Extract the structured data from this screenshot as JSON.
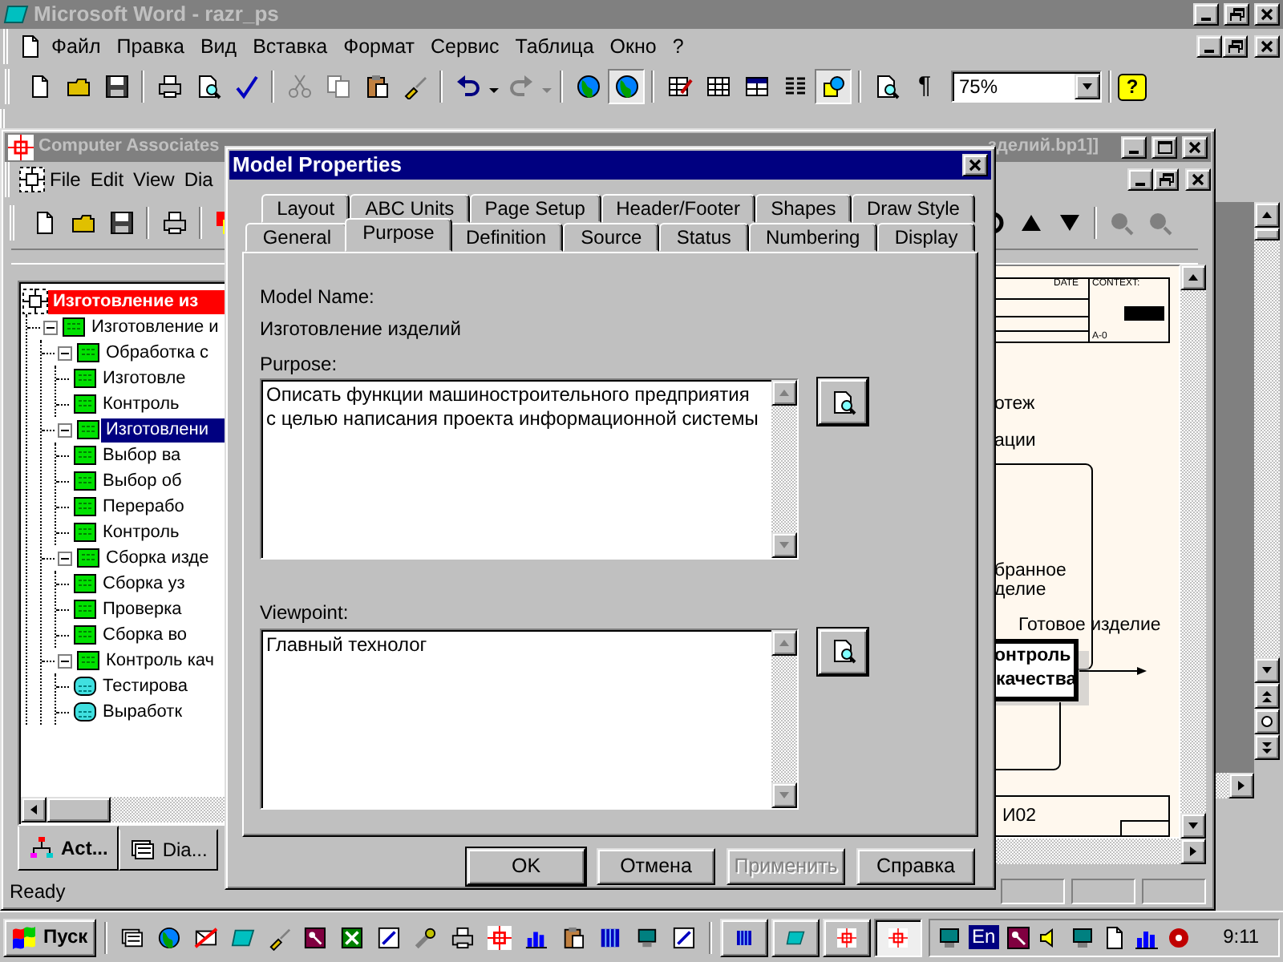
{
  "word_window": {
    "title": "Microsoft Word - razr_ps",
    "menu": [
      "Файл",
      "Правка",
      "Вид",
      "Вставка",
      "Формат",
      "Сервис",
      "Таблица",
      "Окно",
      "?"
    ],
    "pilcrow": "¶",
    "zoom": "75%",
    "help": "?"
  },
  "bpwin_window": {
    "title_left": "Computer Associates",
    "title_right": "зделий.bp1]]",
    "menu": [
      "File",
      "Edit",
      "View",
      "Dia"
    ],
    "tree": [
      {
        "label": "Изготовление из",
        "kind": "root",
        "selected": false,
        "children": [
          {
            "label": "Изготовление и",
            "kind": "box",
            "selected": false,
            "expanded": true,
            "children": [
              {
                "label": "Обработка  с",
                "kind": "box",
                "selected": false,
                "expanded": true,
                "children": [
                  {
                    "label": "Изготовле",
                    "kind": "box",
                    "selected": false
                  },
                  {
                    "label": "Контроль",
                    "kind": "box",
                    "selected": false
                  }
                ]
              },
              {
                "label": "Изготовлени",
                "kind": "box",
                "selected": true,
                "expanded": true,
                "children": [
                  {
                    "label": "Выбор  ва",
                    "kind": "box",
                    "selected": false
                  },
                  {
                    "label": "Выбор об",
                    "kind": "box",
                    "selected": false
                  },
                  {
                    "label": "Перерабо",
                    "kind": "box",
                    "selected": false
                  },
                  {
                    "label": "Контроль",
                    "kind": "box",
                    "selected": false
                  }
                ]
              },
              {
                "label": "Сборка изде",
                "kind": "box",
                "selected": false,
                "expanded": true,
                "children": [
                  {
                    "label": "Сборка уз",
                    "kind": "box",
                    "selected": false
                  },
                  {
                    "label": "Проверка",
                    "kind": "box",
                    "selected": false
                  },
                  {
                    "label": "Сборка во",
                    "kind": "box",
                    "selected": false
                  }
                ]
              },
              {
                "label": "Контроль кач",
                "kind": "box",
                "selected": false,
                "expanded": true,
                "children": [
                  {
                    "label": "Тестирова",
                    "kind": "round",
                    "selected": false
                  },
                  {
                    "label": "Выработк",
                    "kind": "round",
                    "selected": false
                  }
                ]
              }
            ]
          }
        ]
      }
    ],
    "panel_tabs": [
      {
        "label": "Act...",
        "selected": true
      },
      {
        "label": "Dia...",
        "selected": false
      }
    ],
    "diagram": {
      "date": "DATE",
      "context": "CONTEXT:",
      "node": "A-0",
      "text_1": "отеж",
      "text_2": "ации",
      "text_3": "бранное",
      "text_4": "делие",
      "output": "Готовое изделие",
      "box_line_1": "онтроль",
      "box_line_2": "качества",
      "number": "И02"
    },
    "status": "Ready"
  },
  "dialog": {
    "title": "Model Properties",
    "tab_rows": [
      [
        {
          "label": "Layout",
          "selected": false
        },
        {
          "label": "ABC Units",
          "selected": false
        },
        {
          "label": "Page Setup",
          "selected": false
        },
        {
          "label": "Header/Footer",
          "selected": false
        },
        {
          "label": "Shapes",
          "selected": false
        },
        {
          "label": "Draw Style",
          "selected": false
        }
      ],
      [
        {
          "label": "General",
          "selected": false
        },
        {
          "label": "Purpose",
          "selected": true
        },
        {
          "label": "Definition",
          "selected": false
        },
        {
          "label": "Source",
          "selected": false
        },
        {
          "label": "Status",
          "selected": false
        },
        {
          "label": "Numbering",
          "selected": false
        },
        {
          "label": "Display",
          "selected": false
        }
      ]
    ],
    "model_name_label": "Model Name:",
    "model_name": "Изготовление изделий",
    "purpose_label": "Purpose:",
    "purpose": "Описать функции машиностроительного предприятия\nс целью написания проекта информационной системы",
    "viewpoint_label": "Viewpoint:",
    "viewpoint": "Главный технолог",
    "buttons": [
      {
        "label": "OK",
        "default": true,
        "disabled": false
      },
      {
        "label": "Отмена",
        "default": false,
        "disabled": false
      },
      {
        "label": "Применить",
        "default": false,
        "disabled": true
      },
      {
        "label": "Справка",
        "default": false,
        "disabled": false
      }
    ]
  },
  "taskbar": {
    "start": "Пуск",
    "language": "En",
    "clock": "9:11"
  }
}
